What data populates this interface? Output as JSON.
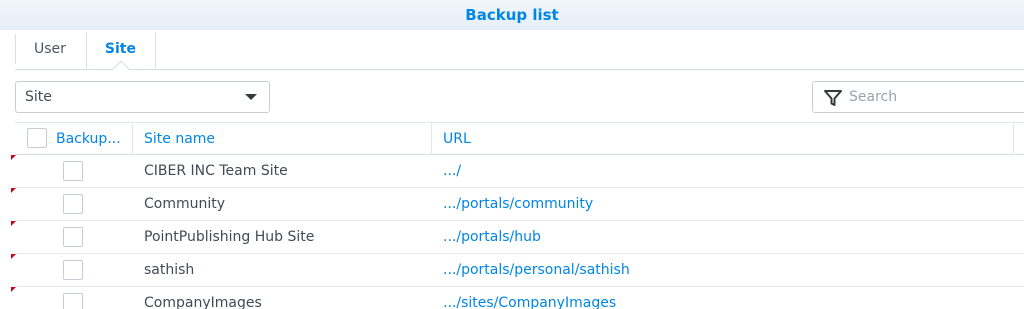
{
  "window": {
    "title": "Backup list"
  },
  "tabs": [
    {
      "label": "User",
      "active": false
    },
    {
      "label": "Site",
      "active": true
    }
  ],
  "filter_select": {
    "value": "Site"
  },
  "search": {
    "placeholder": "Search"
  },
  "table": {
    "columns": [
      "Backup...",
      "Site name",
      "URL"
    ],
    "rows": [
      {
        "checked": false,
        "site_name": "CIBER INC Team Site",
        "url": ".../"
      },
      {
        "checked": false,
        "site_name": "Community",
        "url": ".../portals/community"
      },
      {
        "checked": false,
        "site_name": "PointPublishing Hub Site",
        "url": ".../portals/hub"
      },
      {
        "checked": false,
        "site_name": "sathish",
        "url": ".../portals/personal/sathish"
      },
      {
        "checked": false,
        "site_name": "CompanyImages",
        "url": ".../sites/CompanyImages"
      }
    ]
  },
  "colors": {
    "accent": "#0086e5",
    "dirty_marker": "#d0021b"
  }
}
